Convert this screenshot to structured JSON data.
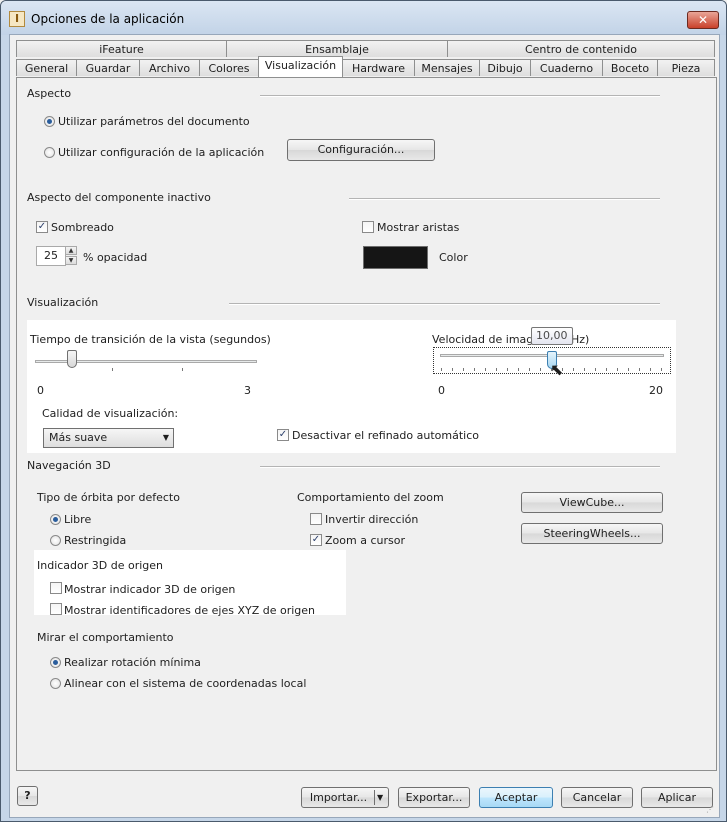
{
  "window": {
    "title": "Opciones de la aplicación",
    "close_glyph": "✕"
  },
  "tabs_top": [
    "iFeature",
    "Ensamblaje",
    "Centro de contenido"
  ],
  "tabs_bottom": [
    "General",
    "Guardar",
    "Archivo",
    "Colores",
    "Visualización",
    "Hardware",
    "Mensajes",
    "Dibujo",
    "Cuaderno",
    "Boceto",
    "Pieza"
  ],
  "aspecto": {
    "title": "Aspecto",
    "radio_doc": "Utilizar parámetros del documento",
    "radio_app": "Utilizar configuración de la aplicación",
    "config_button": "Configuración..."
  },
  "inactivo": {
    "title": "Aspecto del componente inactivo",
    "sombreado": "Sombreado",
    "mostrar_aristas": "Mostrar aristas",
    "opacidad_value": "25",
    "opacidad_label": "% opacidad",
    "color_label": "Color",
    "color_value": "#151515"
  },
  "visualizacion": {
    "title": "Visualización",
    "transicion_label": "Tiempo de transición de la vista (segundos)",
    "transicion_min": "0",
    "transicion_max": "3",
    "transicion_value": 0.5,
    "velocidad_label": "Velocidad de imagen",
    "velocidad_suffix": "Hz)",
    "velocidad_tooltip": "10,00",
    "velocidad_min": "0",
    "velocidad_max": "20",
    "velocidad_value": 10,
    "calidad_label": "Calidad de visualización:",
    "calidad_value": "Más suave",
    "refinado_label": "Desactivar el refinado automático"
  },
  "nav3d": {
    "title": "Navegación 3D",
    "orbita_title": "Tipo de órbita por defecto",
    "orbita_libre": "Libre",
    "orbita_restringida": "Restringida",
    "zoom_title": "Comportamiento del zoom",
    "zoom_invertir": "Invertir dirección",
    "zoom_cursor": "Zoom a cursor",
    "viewcube_button": "ViewCube...",
    "steering_button": "SteeringWheels...",
    "indicador_title": "Indicador 3D de origen",
    "indicador_mostrar": "Mostrar indicador 3D de origen",
    "indicador_ejes": "Mostrar identificadores de ejes XYZ de origen",
    "mirar_title": "Mirar el comportamiento",
    "mirar_rotacion": "Realizar rotación mínima",
    "mirar_alinear": "Alinear con el sistema de coordenadas local"
  },
  "footer": {
    "help_icon": "help-icon",
    "importar": "Importar...",
    "exportar": "Exportar...",
    "aceptar": "Aceptar",
    "cancelar": "Cancelar",
    "aplicar": "Aplicar"
  }
}
